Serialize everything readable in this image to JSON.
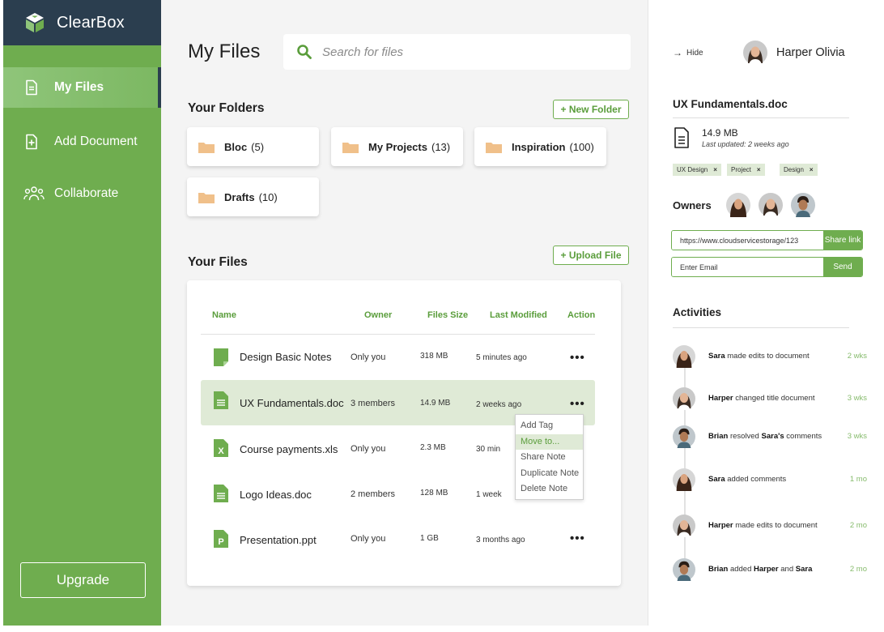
{
  "app": {
    "name": "ClearBox"
  },
  "colors": {
    "sidebar": "#6fad4f",
    "brand_bar": "#2b3e4f",
    "accent": "#5a9d3b",
    "selected_row": "#dfead6",
    "folder": "#f0c08a"
  },
  "sidebar": {
    "items": [
      {
        "label": "My Files",
        "icon": "document-icon",
        "active": true
      },
      {
        "label": "Add Document",
        "icon": "add-document-icon",
        "active": false
      },
      {
        "label": "Collaborate",
        "icon": "people-icon",
        "active": false
      }
    ],
    "upgrade_label": "Upgrade"
  },
  "header": {
    "title": "My Files",
    "search_placeholder": "Search for files"
  },
  "folders": {
    "title": "Your Folders",
    "new_folder_label": "+ New Folder",
    "items": [
      {
        "name": "Bloc",
        "count": "(5)"
      },
      {
        "name": "My Projects",
        "count": "(13)"
      },
      {
        "name": "Inspiration",
        "count": "(100)"
      },
      {
        "name": "Drafts",
        "count": "(10)"
      }
    ]
  },
  "files": {
    "title": "Your Files",
    "upload_label": "+ Upload File",
    "columns": [
      "Name",
      "Owner",
      "Files Size",
      "Last Modified",
      "Action"
    ],
    "rows": [
      {
        "name": "Design Basic Notes",
        "owner": "Only you",
        "size": "318 MB",
        "modified": "5 minutes ago",
        "action": "•••",
        "icon": "note-icon"
      },
      {
        "name": "UX Fundamentals.doc",
        "owner": "3 members",
        "size": "14.9 MB",
        "modified": "2 weeks ago",
        "action": "•••",
        "icon": "doc-icon"
      },
      {
        "name": "Course payments.xls",
        "owner": "Only you",
        "size": "2.3 MB",
        "modified": "30 min",
        "action": "",
        "icon": "xls-icon"
      },
      {
        "name": "Logo Ideas.doc",
        "owner": "2 members",
        "size": "128 MB",
        "modified": "1 week",
        "action": "",
        "icon": "doc-icon"
      },
      {
        "name": "Presentation.ppt",
        "owner": "Only you",
        "size": "1 GB",
        "modified": "3 months ago",
        "action": "•••",
        "icon": "ppt-icon"
      }
    ]
  },
  "context_menu": {
    "items": [
      "Add Tag",
      "Move to...",
      "Share Note",
      "Duplicate Note",
      "Delete Note"
    ],
    "highlighted": "Move to..."
  },
  "details": {
    "hide_label": "Hide",
    "user_name": "Harper Olivia",
    "doc_title": "UX Fundamentals.doc",
    "size": "14.9 MB",
    "updated": "Last updated: 2 weeks ago",
    "tags": [
      "UX Design",
      "Project",
      "Design"
    ],
    "tag_remove": "×",
    "owners_label": "Owners",
    "share_url": "https://www.cloudservicestorage/123",
    "share_button": "Share link",
    "email_placeholder": "Enter Email",
    "send_button": "Send",
    "activities_title": "Activities",
    "activities": [
      {
        "who": "Sara",
        "text": "made edits to document",
        "when": "2 wks"
      },
      {
        "who": "Harper",
        "text": "changed title document",
        "when": "3 wks"
      },
      {
        "who": "Brian",
        "text": "resolved",
        "who2": "Sara's",
        "text2": "comments",
        "when": "3 wks"
      },
      {
        "who": "Sara",
        "text": "added comments",
        "when": "1 mo"
      },
      {
        "who": "Harper",
        "text": "made edits to document",
        "when": "2 mo"
      },
      {
        "who": "Brian",
        "text": "added",
        "who2": "Harper",
        "text2": "and",
        "who3": "Sara",
        "when": "2 mo"
      }
    ]
  }
}
